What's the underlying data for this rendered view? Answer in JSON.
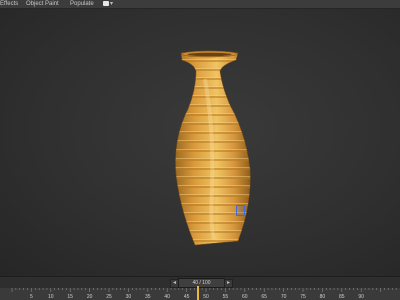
{
  "menu": {
    "items": [
      "Effects",
      "Object Paint",
      "Populate"
    ],
    "more_glyph": "▾"
  },
  "timeline": {
    "frame_display": "40 / 100",
    "prev_glyph": "◂",
    "next_glyph": "▸",
    "ticks": [
      "5",
      "10",
      "15",
      "20",
      "25",
      "30",
      "35",
      "40",
      "45",
      "50",
      "55",
      "60",
      "65",
      "70",
      "75",
      "80",
      "85",
      "90"
    ]
  },
  "colors": {
    "accent": "#e8b83a",
    "vase_light": "#e8b54c",
    "vase_dark": "#a8742a"
  }
}
